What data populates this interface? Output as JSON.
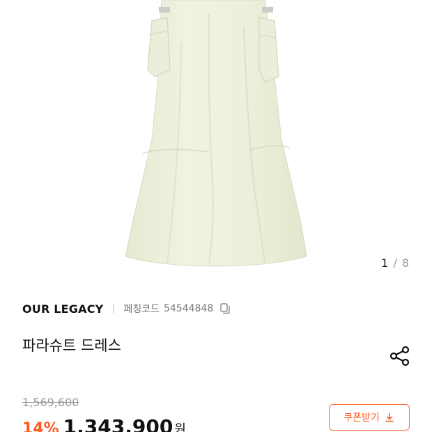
{
  "gallery": {
    "current": "1",
    "separator": "/",
    "total": "8"
  },
  "product": {
    "brand": "OUR LEGACY",
    "code_label": "페칭코드",
    "code_value": "54544848",
    "title": "파라슈트 드레스"
  },
  "pricing": {
    "original_price": "1,569,600",
    "discount": "14%",
    "sale_price": "1,343,900",
    "currency": "원"
  },
  "coupon": {
    "label": "쿠폰받기"
  },
  "colors": {
    "accent": "#ff5a1f",
    "dress": "#eef0dc"
  },
  "icons": {
    "copy": "copy-icon",
    "share": "share-icon",
    "download": "download-icon"
  }
}
